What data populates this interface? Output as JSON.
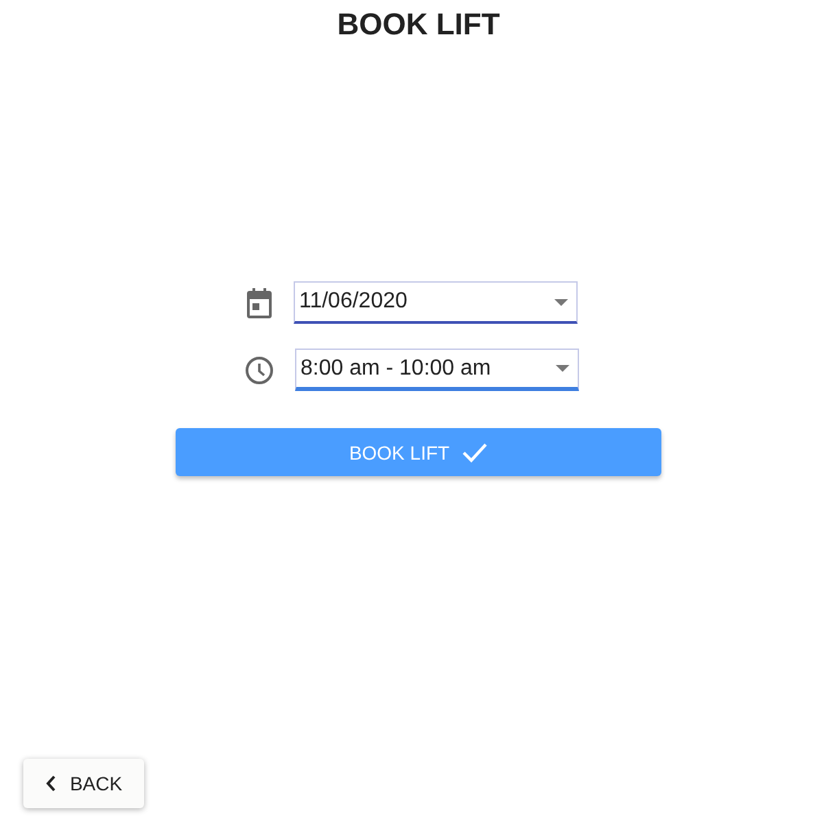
{
  "title": "BOOK LIFT",
  "fields": [
    {
      "kind": "date",
      "value": "11/06/2020",
      "focused": false
    },
    {
      "kind": "time",
      "value": "8:00 am - 10:00 am",
      "focused": true
    }
  ],
  "submit_button": {
    "label": "BOOK LIFT"
  },
  "back_button": {
    "label": "BACK"
  }
}
